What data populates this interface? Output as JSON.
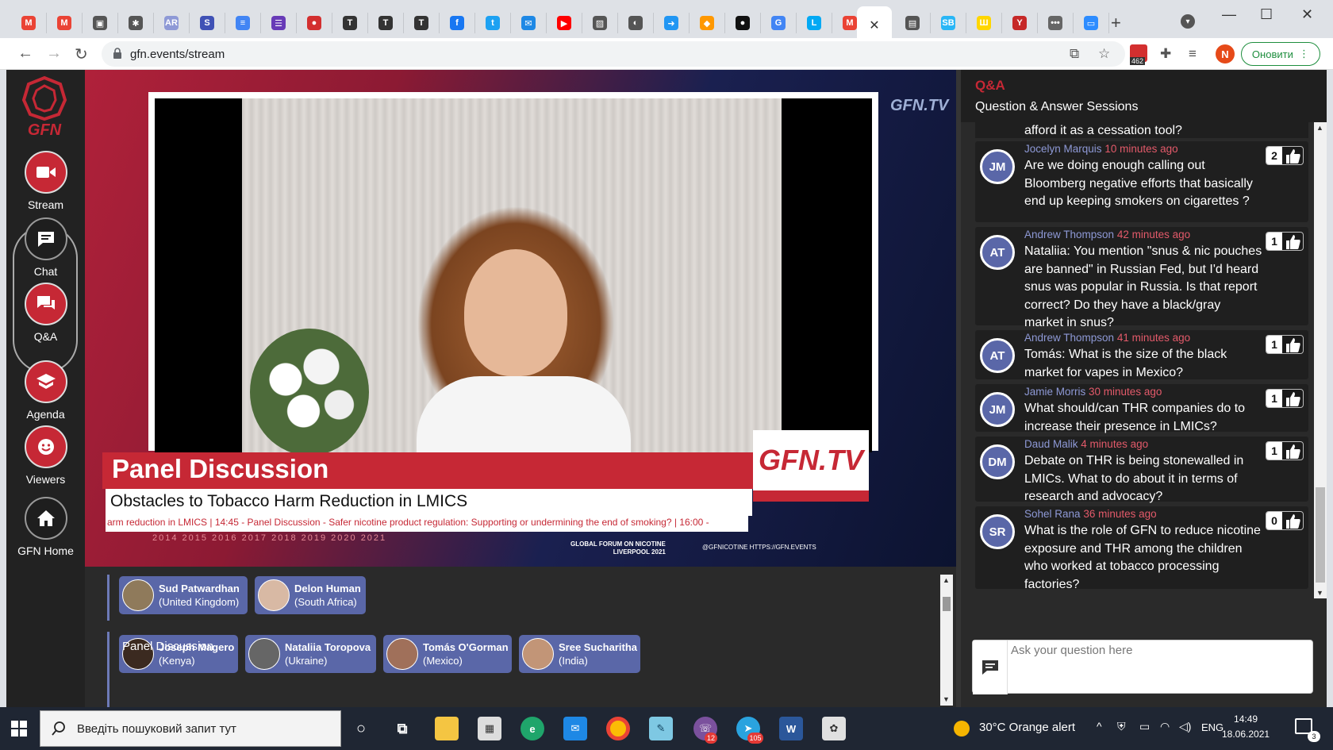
{
  "browser": {
    "url": "gfn.events/stream",
    "update_label": "Оновити",
    "profile_initial": "N",
    "ext_badge_count": "462",
    "tab_favicons": [
      {
        "name": "gmail-icon",
        "glyph": "M",
        "color": "#ea4335"
      },
      {
        "name": "gmail-icon",
        "glyph": "M",
        "color": "#ea4335"
      },
      {
        "name": "save-icon",
        "glyph": "▣",
        "color": "#555555"
      },
      {
        "name": "settings-icon",
        "glyph": "✱",
        "color": "#555555"
      },
      {
        "name": "ar-icon",
        "glyph": "AR",
        "color": "#8e99d6"
      },
      {
        "name": "sfw-icon",
        "glyph": "S",
        "color": "#3f51b5"
      },
      {
        "name": "docs-icon",
        "glyph": "≡",
        "color": "#4285f4"
      },
      {
        "name": "forms-icon",
        "glyph": "☰",
        "color": "#673ab7"
      },
      {
        "name": "stop-icon",
        "glyph": "●",
        "color": "#d32f2f"
      },
      {
        "name": "t-icon",
        "glyph": "T",
        "color": "#333333"
      },
      {
        "name": "t-icon",
        "glyph": "T",
        "color": "#333333"
      },
      {
        "name": "t-icon",
        "glyph": "T",
        "color": "#333333"
      },
      {
        "name": "facebook-icon",
        "glyph": "f",
        "color": "#1877f2"
      },
      {
        "name": "twitter-icon",
        "glyph": "t",
        "color": "#1da1f2"
      },
      {
        "name": "sms-icon",
        "glyph": "✉",
        "color": "#1e88e5"
      },
      {
        "name": "youtube-icon",
        "glyph": "▶",
        "color": "#ff0000"
      },
      {
        "name": "image-icon",
        "glyph": "▨",
        "color": "#555555"
      },
      {
        "name": "globe-icon",
        "glyph": "◐",
        "color": "#555555"
      },
      {
        "name": "arrow-icon",
        "glyph": "➜",
        "color": "#2196f3"
      },
      {
        "name": "shield-icon",
        "glyph": "◆",
        "color": "#ff9800"
      },
      {
        "name": "medium-icon",
        "glyph": "●",
        "color": "#111111"
      },
      {
        "name": "translate-icon",
        "glyph": "G",
        "color": "#4285f4"
      },
      {
        "name": "l-icon",
        "glyph": "L",
        "color": "#03a9f4"
      },
      {
        "name": "gmail-icon",
        "glyph": "M",
        "color": "#ea4335"
      }
    ],
    "tab_favicons_right": [
      {
        "name": "table-icon",
        "glyph": "▤",
        "color": "#555555"
      },
      {
        "name": "sb-icon",
        "glyph": "SB",
        "color": "#29b6f6"
      },
      {
        "name": "trident-icon",
        "glyph": "Ш",
        "color": "#ffd600"
      },
      {
        "name": "yt-icon",
        "glyph": "Y",
        "color": "#c62828"
      },
      {
        "name": "dots-icon",
        "glyph": "•••",
        "color": "#666666"
      },
      {
        "name": "zoom-icon",
        "glyph": "▭",
        "color": "#2d8cff"
      }
    ]
  },
  "sidebar": {
    "logo_text": "GFN",
    "items": [
      {
        "label": "Stream"
      },
      {
        "label": "Chat"
      },
      {
        "label": "Q&A"
      },
      {
        "label": "Agenda"
      },
      {
        "label": "Viewers"
      },
      {
        "label": "GFN Home"
      }
    ]
  },
  "video": {
    "corner_logo": "GFN.TV",
    "title": "Panel Discussion",
    "subtitle": "Obstacles to Tobacco Harm Reduction in LMICS",
    "ticker": "arm reduction in LMICS | 14:45 - Panel Discussion - Safer nicotine product regulation: Supporting or undermining the end of smoking? | 16:00 -",
    "years": "2014  2015  2016  2017  2018  2019  2020  2021",
    "brand_box": "GFN.TV",
    "forum_line1": "GLOBAL FORUM ON NICOTINE",
    "forum_line2": "LIVERPOOL 2021",
    "forum_social": "@GFNICOTINE    HTTPS://GFN.EVENTS"
  },
  "speakers": {
    "group1": [
      {
        "name": "Sud Patwardhan",
        "country": "(United Kingdom)"
      },
      {
        "name": "Delon Human",
        "country": "(South Africa)"
      }
    ],
    "group2": [
      {
        "name": "Joseph Magero",
        "country": "(Kenya)"
      },
      {
        "name": "Nataliia Toropova",
        "country": "(Ukraine)"
      },
      {
        "name": "Tomás O'Gorman",
        "country": "(Mexico)"
      },
      {
        "name": "Sree Sucharitha",
        "country": "(India)"
      }
    ],
    "group2_label": "Panel Discussion"
  },
  "qa": {
    "title": "Q&A",
    "subtitle": "Question & Answer Sessions",
    "top_fragment": "afford it as a cessation tool?",
    "questions": [
      {
        "initials": "JM",
        "author": "Jocelyn Marquis",
        "time": "10 minutes ago",
        "votes": "2",
        "text": "Are we doing enough calling out Bloomberg negative efforts that basically end up keeping smokers on cigarettes ?"
      },
      {
        "initials": "AT",
        "author": "Andrew Thompson",
        "time": "42 minutes ago",
        "votes": "1",
        "text": "Nataliia: You mention \"snus & nic pouches are banned\" in Russian Fed, but I'd heard snus was popular in Russia. Is that report correct? Do they have a black/gray market in snus?"
      },
      {
        "initials": "AT",
        "author": "Andrew Thompson",
        "time": "41 minutes ago",
        "votes": "1",
        "text": "Tomás: What is the size of the black market for vapes in Mexico?"
      },
      {
        "initials": "JM",
        "author": "Jamie Morris",
        "time": "30 minutes ago",
        "votes": "1",
        "text": "What should/can THR companies do to increase their presence in LMICs?"
      },
      {
        "initials": "DM",
        "author": "Daud Malik",
        "time": "4 minutes ago",
        "votes": "1",
        "text": "Debate on THR is being stonewalled in LMICs. What to do about it in terms of research and advocacy?"
      },
      {
        "initials": "SR",
        "author": "Sohel Rana",
        "time": "36 minutes ago",
        "votes": "0",
        "text": "What is the role of GFN to reduce nicotine exposure and THR among the children who worked at tobacco processing factories?"
      }
    ],
    "input_placeholder": "Ask your question here"
  },
  "taskbar": {
    "search_placeholder": "Введіть пошуковий запит тут",
    "weather": "30°C  Orange alert",
    "language": "ENG",
    "time": "14:49",
    "date": "18.06.2021",
    "notif_count": "3",
    "viber_badge": "12",
    "telegram_badge": "105"
  }
}
